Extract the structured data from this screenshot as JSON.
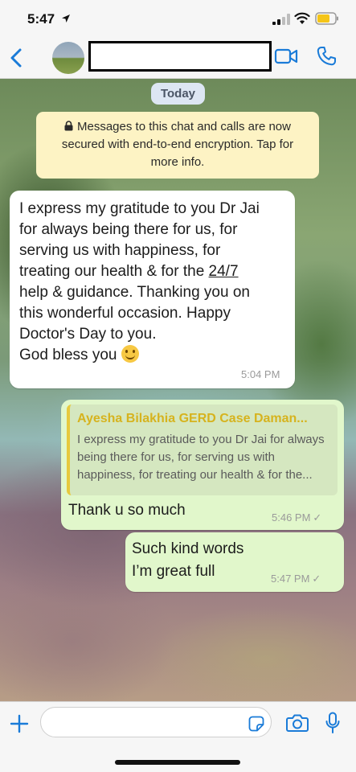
{
  "status_bar": {
    "time": "5:47"
  },
  "header": {
    "contact_name": ""
  },
  "chat": {
    "day_label": "Today",
    "encryption_notice": "Messages to this chat and calls are now secured with end-to-end encryption. Tap for more info.",
    "messages": [
      {
        "direction": "incoming",
        "text_part1": "I express my gratitude to you Dr Jai\nfor always being there for us, for\nserving us with happiness, for\ntreating our health & for the ",
        "text_underlined": "24/7",
        "text_part2": "\nhelp & guidance. Thanking you on\nthis wonderful occasion. Happy\nDoctor's Day to you.\nGod bless you ",
        "time": "5:04 PM"
      },
      {
        "direction": "outgoing",
        "quote_author": "Ayesha Bilakhia GERD Case Daman...",
        "quote_text": "I express my gratitude to you Dr Jai for always being there for us, for serving us with happiness, for treating our health & for the...",
        "text": "Thank u so much",
        "time": "5:46 PM"
      },
      {
        "direction": "outgoing",
        "text": "Such kind words\nI’m great full",
        "time": "5:47 PM"
      }
    ]
  },
  "colors": {
    "accent": "#1a7bd8",
    "outgoing_bubble": "#e1f7cb",
    "incoming_bubble": "#ffffff",
    "notice_bg": "#fdf3c4",
    "quote_author": "#d6b31e"
  },
  "icons": {
    "back": "chevron-left-icon",
    "video": "video-camera-icon",
    "call": "phone-icon",
    "plus": "plus-icon",
    "sticker": "sticker-icon",
    "camera": "camera-icon",
    "mic": "microphone-icon",
    "emoji": "smiling-face-emoji"
  }
}
